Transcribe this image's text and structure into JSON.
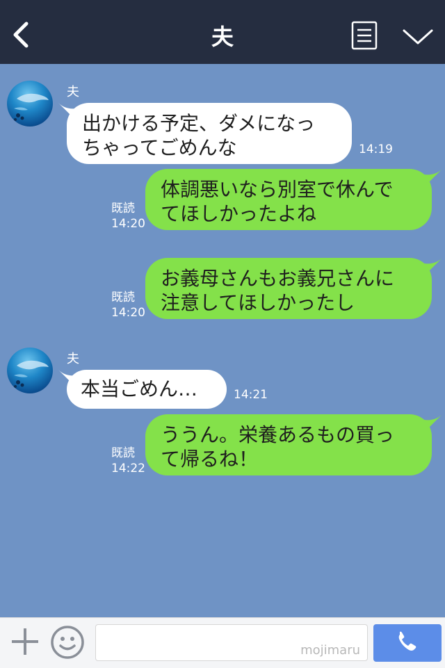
{
  "header": {
    "title": "夫"
  },
  "messages": [
    {
      "sender": "夫",
      "lines": [
        "出かける予定、ダメになっ",
        "ちゃってごめんな"
      ],
      "time": "14:19"
    },
    {
      "lines": [
        "体調悪いなら別室で休んで",
        "てほしかったよね"
      ],
      "read": "既読",
      "time": "14:20"
    },
    {
      "lines": [
        "お義母さんもお義兄さんに",
        "注意してほしかったし"
      ],
      "read": "既読",
      "time": "14:20"
    },
    {
      "sender": "夫",
      "lines": [
        "本当ごめん…"
      ],
      "time": "14:21"
    },
    {
      "lines": [
        "ううん。栄養あるもの買っ",
        "て帰るね！"
      ],
      "read": "既読",
      "time": "14:22"
    }
  ],
  "input": {
    "watermark": "mojimaru"
  },
  "icons": {
    "back": "chevron-left-icon",
    "menu": "note-icon",
    "collapse": "chevron-down-icon",
    "plus": "plus-icon",
    "emoji": "smiley-icon",
    "call": "phone-icon"
  },
  "colors": {
    "header_bg": "#252d40",
    "chat_bg": "#6f93c5",
    "incoming_bubble": "#ffffff",
    "outgoing_bubble": "#84e14a",
    "call_button": "#5c8de8"
  }
}
